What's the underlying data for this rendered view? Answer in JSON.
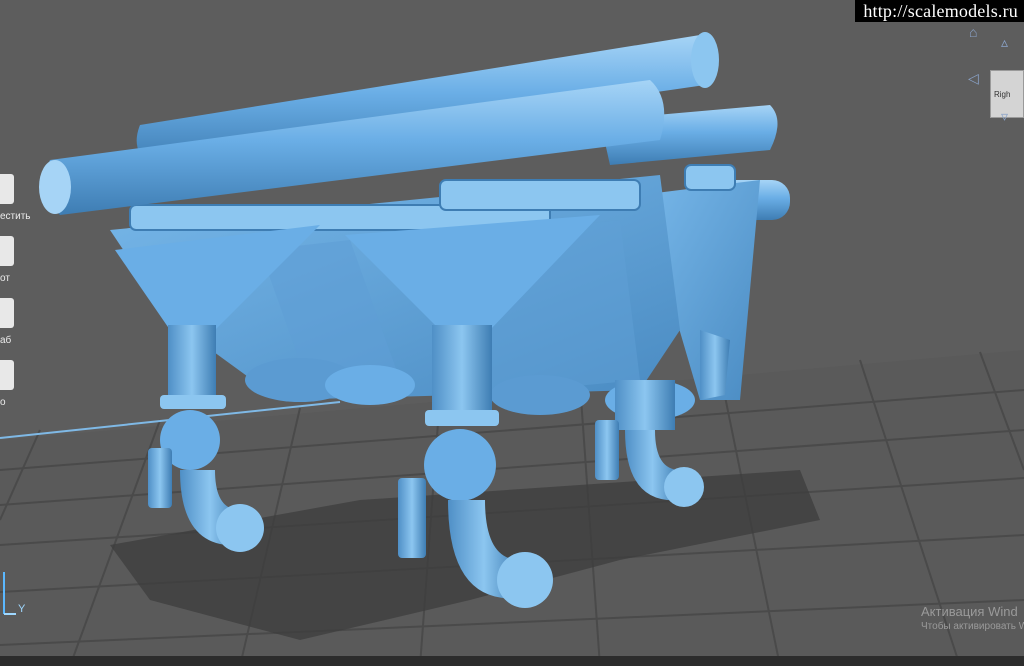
{
  "watermark": {
    "text": "http://scalemodels.ru"
  },
  "sidebar": {
    "items": [
      {
        "label": "естить",
        "icon": "place-icon"
      },
      {
        "label": "от",
        "icon": "rotate-icon"
      },
      {
        "label": "аб",
        "icon": "scale-icon"
      },
      {
        "label": "о",
        "icon": "mirror-icon"
      }
    ]
  },
  "viewcube": {
    "face_label": "Righ",
    "icons": [
      "home-icon",
      "arrow-up-icon",
      "arrow-left-icon",
      "arrow-down-icon"
    ]
  },
  "axes": {
    "y_label": "Y",
    "z_color": "#5bb8ff",
    "y_color": "#9fd8ff"
  },
  "activation": {
    "title": "Активация Wind",
    "subtitle": "Чтобы активировать W"
  },
  "colors": {
    "viewport_bg": "#5d5d5d",
    "build_plate_line": "#4a4a4a",
    "model_fill": "#6aaee6",
    "model_shade": "#3e7db3",
    "model_highlight": "#a6d4f6",
    "accent": "#5bb8ff"
  }
}
